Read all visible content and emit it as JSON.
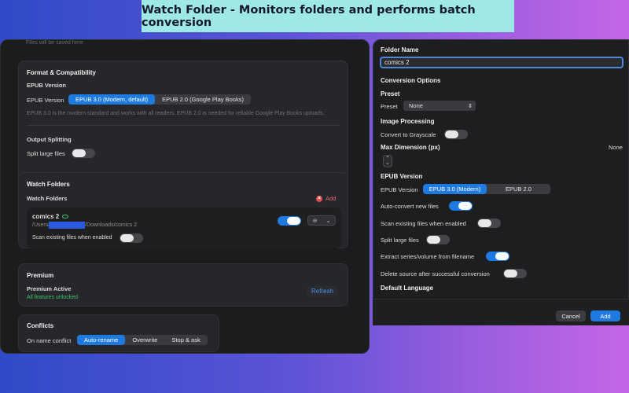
{
  "banner": {
    "title": "Watch Folder - Monitors folders and performs batch conversion"
  },
  "settings": {
    "scroll_hint": "Files will be saved here",
    "format": {
      "title": "Format & Compatibility",
      "epub_heading": "EPUB Version",
      "epub_label": "EPUB Version",
      "options": [
        "EPUB 3.0 (Modern, default)",
        "EPUB 2.0 (Google Play Books)"
      ],
      "selected_index": 0,
      "help": "EPUB 3.0 is the modern standard and works with all readers. EPUB 2.0 is needed for reliable Google Play Books uploads.",
      "split_heading": "Output Splitting",
      "split_label": "Split large files",
      "split_on": false
    },
    "watch": {
      "card_title": "Watch Folders",
      "subtitle": "Watch Folders",
      "add_label": "Add",
      "folder": {
        "name": "comics 2",
        "path_prefix": "/Users/",
        "path_suffix": "/Downloads/comics 2",
        "scan_label": "Scan existing files when enabled",
        "enabled": true,
        "scan_on": false
      }
    },
    "premium": {
      "title": "Premium",
      "status": "Premium Active",
      "detail": "All features unlocked",
      "refresh_label": "Refresh"
    },
    "conflicts": {
      "title": "Conflicts",
      "label": "On name conflict",
      "options": [
        "Auto-rename",
        "Overwrite",
        "Stop & ask"
      ],
      "selected_index": 0
    }
  },
  "dialog": {
    "folder_name_label": "Folder Name",
    "folder_name_value": "comics 2",
    "conversion_options": "Conversion Options",
    "preset_heading": "Preset",
    "preset_label": "Preset",
    "preset_value": "None",
    "image_processing": "Image Processing",
    "grayscale_label": "Convert to Grayscale",
    "max_dim_label": "Max Dimension (px)",
    "max_dim_value": "None",
    "epub_heading": "EPUB Version",
    "epub_label": "EPUB Version",
    "epub_options": [
      "EPUB 3.0 (Modern)",
      "EPUB 2.0"
    ],
    "epub_selected_index": 0,
    "toggles": [
      {
        "label": "Auto-convert new files",
        "on": true
      },
      {
        "label": "Scan existing files when enabled",
        "on": false
      },
      {
        "label": "Split large files",
        "on": false
      },
      {
        "label": "Extract series/volume from filename",
        "on": true
      },
      {
        "label": "Delete source after successful conversion",
        "on": false
      }
    ],
    "default_language": "Default Language",
    "cancel_label": "Cancel",
    "add_label": "Add"
  }
}
